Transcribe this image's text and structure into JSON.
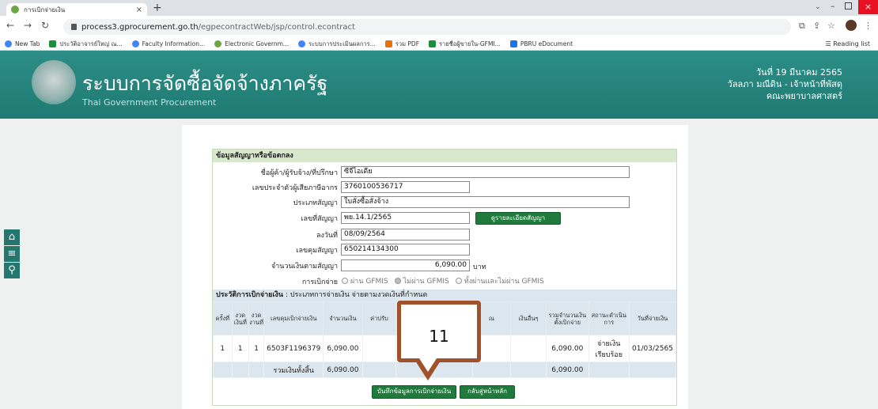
{
  "browser": {
    "tab_title": "การเบิกจ่ายเงิน",
    "url_host": "process3.gprocurement.go.th",
    "url_path": "/egpecontractWeb/jsp/control.econtract",
    "bookmarks": [
      "New Tab",
      "ประวัติอาจารย์ใหญ่ ณ...",
      "Faculty Information...",
      "Electronic Governm...",
      "ระบบการประเมินผลการ...",
      "รวม PDF",
      "รายชื่อผู้ขายใน-GFMI...",
      "PBRU eDocument"
    ],
    "reading_list": "Reading list"
  },
  "header": {
    "title": "ระบบการจัดซื้อจัดจ้างภาครัฐ",
    "subtitle": "Thai Government Procurement",
    "date": "วันที่ 19 มีนาคม 2565",
    "user": "วัลลภา มณีดิน - เจ้าหน้าที่พัสดุ",
    "org": "คณะพยาบาลศาสตร์"
  },
  "contract": {
    "section_title": "ข้อมูลสัญญาหรือข้อตกลง",
    "fields": {
      "vendor_label": "ชื่อผู้ค้า/ผู้รับจ้าง/ที่ปรึกษา",
      "vendor_value": "ซีจีไอเดีย",
      "taxid_label": "เลขประจำตัวผู้เสียภาษีอากร",
      "taxid_value": "3760100536717",
      "type_label": "ประเภทสัญญา",
      "type_value": "ใบสั่งซื้อสั่งจ้าง",
      "no_label": "เลขที่สัญญา",
      "no_value": "พย.14.1/2565",
      "date_label": "ลงวันที่",
      "date_value": "08/09/2564",
      "control_label": "เลขคุมสัญญา",
      "control_value": "650214134300",
      "amount_label": "จำนวนเงินตามสัญญา",
      "amount_value": "6,090.00",
      "amount_unit": "บาท",
      "pay_label": "การเบิกจ่าย"
    },
    "detail_button": "ดูรายละเอียดสัญญา",
    "pay_options": [
      "ผ่าน GFMIS",
      "ไม่ผ่าน GFMIS",
      "ทั้งผ่านและไม่ผ่าน GFMIS"
    ],
    "pay_selected_index": 1
  },
  "history": {
    "title_bold": "ประวัติการเบิกจ่ายเงิน",
    "title_rest": " : ประเภทการจ่ายเงิน จ่ายตามงวดเงินที่กำหนด",
    "headers": [
      "ครั้งที่",
      "งวดเงินที่",
      "งวดงานที่",
      "เลขคุมเบิกจ่ายเงิน",
      "จำนวนเงิน",
      "ค่าปรับ",
      "",
      "",
      "ณ",
      "เงินอื่นๆ",
      "รวมจำนวนเงินตั้งเบิกจ่าย",
      "สถานะดำเนินการ",
      "วันที่จ่ายเงิน"
    ],
    "rows": [
      [
        "1",
        "1",
        "1",
        "6503F1196379",
        "6,090.00",
        "",
        "",
        "",
        "",
        "",
        "6,090.00",
        "จ่ายเงินเรียบร้อย",
        "01/03/2565"
      ]
    ],
    "total_label": "รวมเงินทั้งสิ้น",
    "total_amount": "6,090.00",
    "total_sum": "6,090.00"
  },
  "actions": {
    "save": "บันทึกข้อมูลการเบิกจ่ายเงิน",
    "back": "กลับสู่หน้าหลัก"
  },
  "annotation": {
    "number": "11",
    "color": "#a0522d"
  },
  "colors": {
    "header_bg": "#2c8e87",
    "section_bg": "#d8e8cc",
    "table_head_bg": "#dce6ee",
    "button_green": "#1f7a3c"
  }
}
